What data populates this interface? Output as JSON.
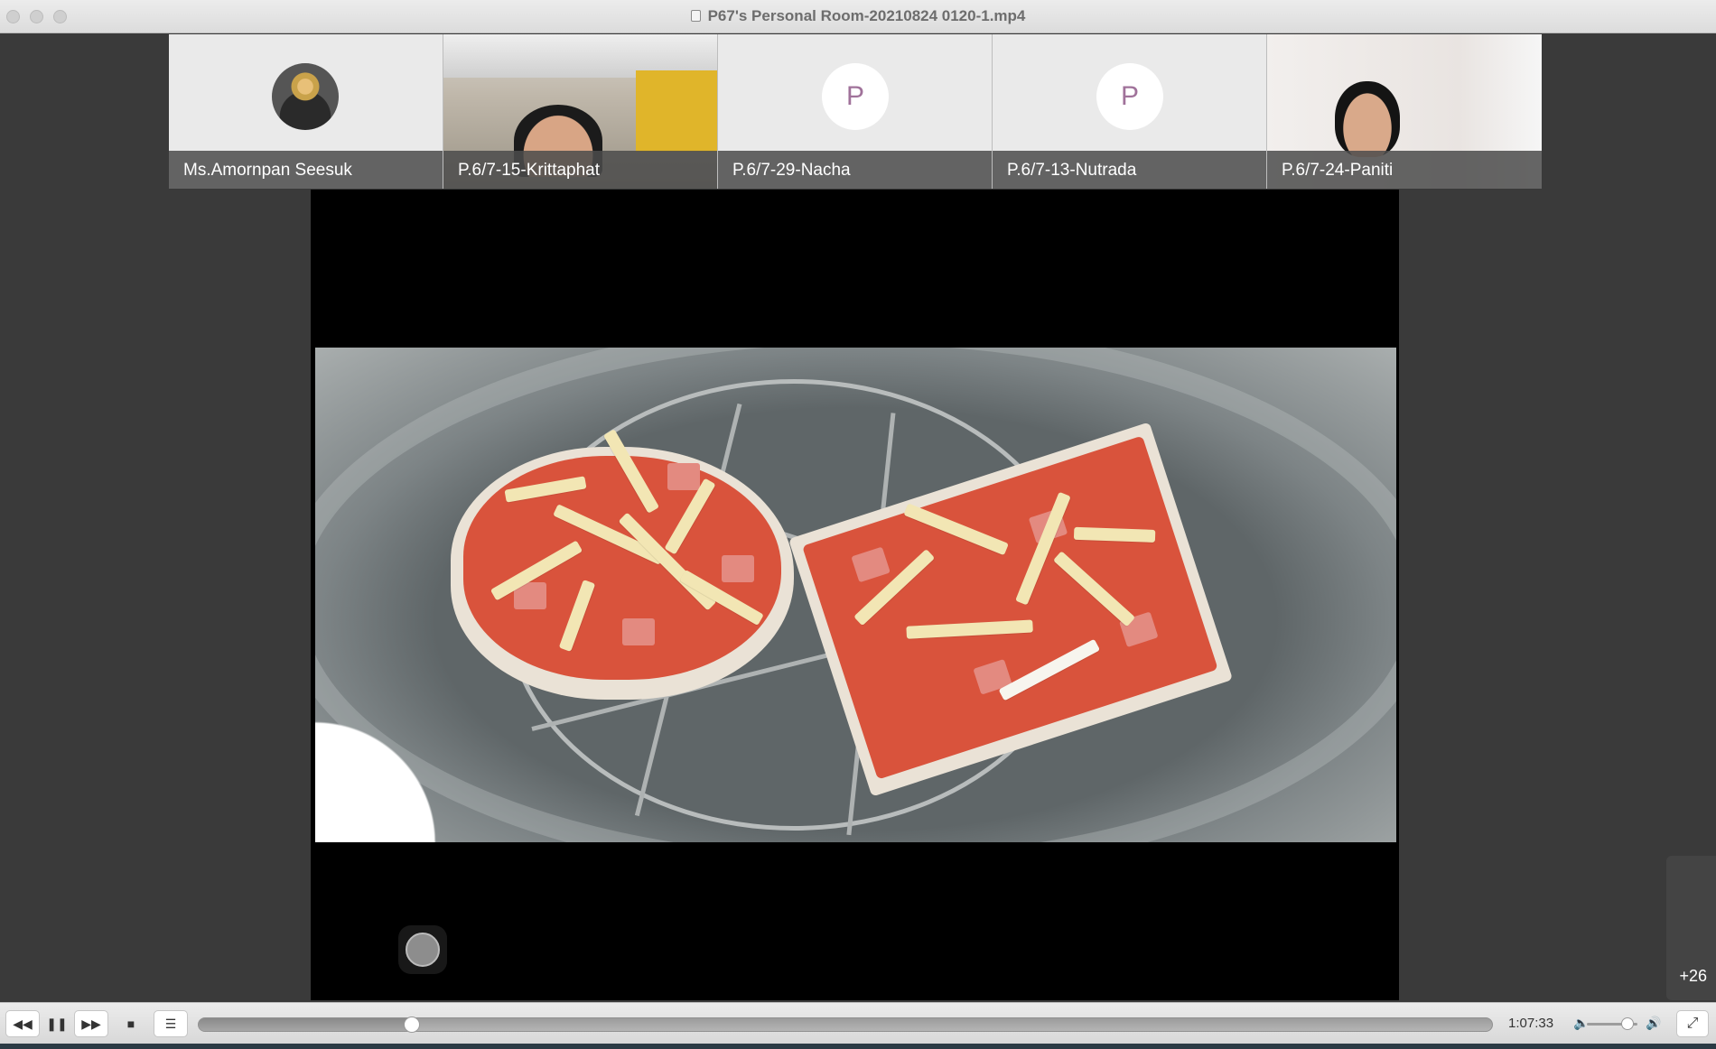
{
  "window": {
    "title": "P67's Personal Room-20210824 0120-1.mp4"
  },
  "participants": [
    {
      "name": "Ms.Amornpan Seesuk",
      "kind": "avatar-photo"
    },
    {
      "name": "P.6/7-15-Krittaphat",
      "kind": "camera"
    },
    {
      "name": "P.6/7-29-Nacha",
      "kind": "letter",
      "initial": "P"
    },
    {
      "name": "P.6/7-13-Nutrada",
      "kind": "letter",
      "initial": "P"
    },
    {
      "name": "P.6/7-24-Paniti",
      "kind": "camera"
    }
  ],
  "overflow": {
    "count_label": "+26"
  },
  "playback": {
    "current_time": "1:07:33",
    "progress_fraction": 0.165,
    "volume_fraction": 0.8,
    "buttons": {
      "rewind": "◀◀",
      "pause": "❚❚",
      "forward": "▶▶",
      "stop": "■",
      "playlist": "☰",
      "fullscreen": "⤢"
    }
  },
  "colors": {
    "stage_background": "#000000",
    "window_chrome": "#e2e2e2",
    "accent_dot": "#f08a24"
  },
  "icons": {
    "document": "doc-icon",
    "volume_low": "speaker-low-icon",
    "volume_high": "speaker-high-icon"
  }
}
